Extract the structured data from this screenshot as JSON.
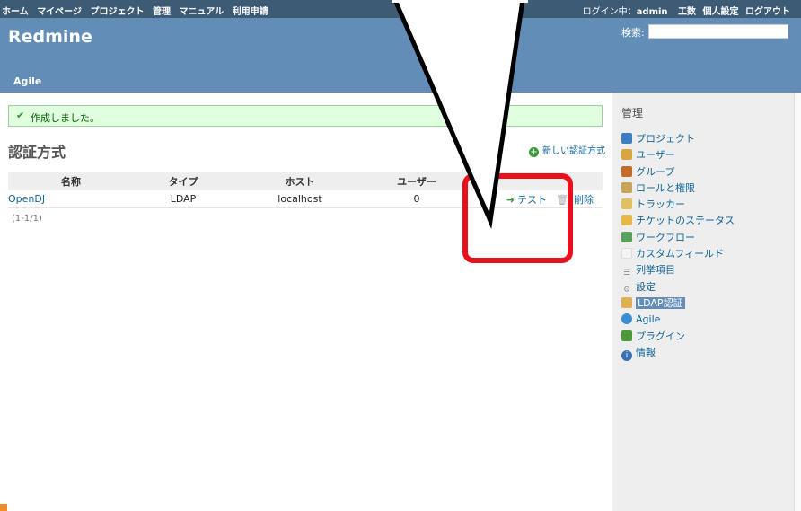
{
  "top_menu": {
    "items": [
      "ホーム",
      "マイページ",
      "プロジェクト",
      "管理",
      "マニュアル",
      "利用申請"
    ],
    "login_label": "ログイン中：",
    "login_user": "admin",
    "right_items": [
      "工数",
      "個人設定",
      "ログアウト"
    ]
  },
  "header": {
    "title": "Redmine",
    "search_label": "検索:",
    "search_value": "",
    "main_menu": "Agile"
  },
  "flash": {
    "icon": "check-icon",
    "message": "作成しました。"
  },
  "page": {
    "title": "認証方式",
    "new_link": "新しい認証方式"
  },
  "table": {
    "headers": [
      "名称",
      "タイプ",
      "ホスト",
      "ユーザー"
    ],
    "rows": [
      {
        "name": "OpenDJ",
        "type": "LDAP",
        "host": "localhost",
        "users": "0",
        "test_label": "テスト",
        "delete_label": "削除"
      }
    ],
    "pagination": "(1-1/1)"
  },
  "sidebar": {
    "title": "管理",
    "items": [
      {
        "label": "プロジェクト",
        "icon": "projects-icon",
        "color": "#3a7fc4"
      },
      {
        "label": "ユーザー",
        "icon": "user-icon",
        "color": "#d9a441"
      },
      {
        "label": "グループ",
        "icon": "group-icon",
        "color": "#c46a2a"
      },
      {
        "label": "ロールと権限",
        "icon": "role-icon",
        "color": "#c8a35a"
      },
      {
        "label": "トラッカー",
        "icon": "tracker-icon",
        "color": "#e0c060"
      },
      {
        "label": "チケットのステータス",
        "icon": "status-icon",
        "color": "#e6b84a"
      },
      {
        "label": "ワークフロー",
        "icon": "workflow-icon",
        "color": "#5aa05a"
      },
      {
        "label": "カスタムフィールド",
        "icon": "custom-field-icon",
        "color": "#f4f4f4"
      },
      {
        "label": "列挙項目",
        "icon": "list-icon",
        "color": "#888888"
      },
      {
        "label": "設定",
        "icon": "settings-icon",
        "color": "#999999"
      },
      {
        "label": "LDAP認証",
        "icon": "ldap-icon",
        "color": "#e0b050"
      },
      {
        "label": "Agile",
        "icon": "agile-icon",
        "color": "#3a8fd4"
      },
      {
        "label": "プラグイン",
        "icon": "plugin-icon",
        "color": "#4a9a3a"
      },
      {
        "label": "情報",
        "icon": "info-icon",
        "color": "#3a6fb4"
      }
    ]
  },
  "colors": {
    "top_menu_bg": "#3e5b76",
    "header_bg": "#628db6",
    "flash_bg": "#dfffdf",
    "annotation_red": "#e8101a"
  }
}
